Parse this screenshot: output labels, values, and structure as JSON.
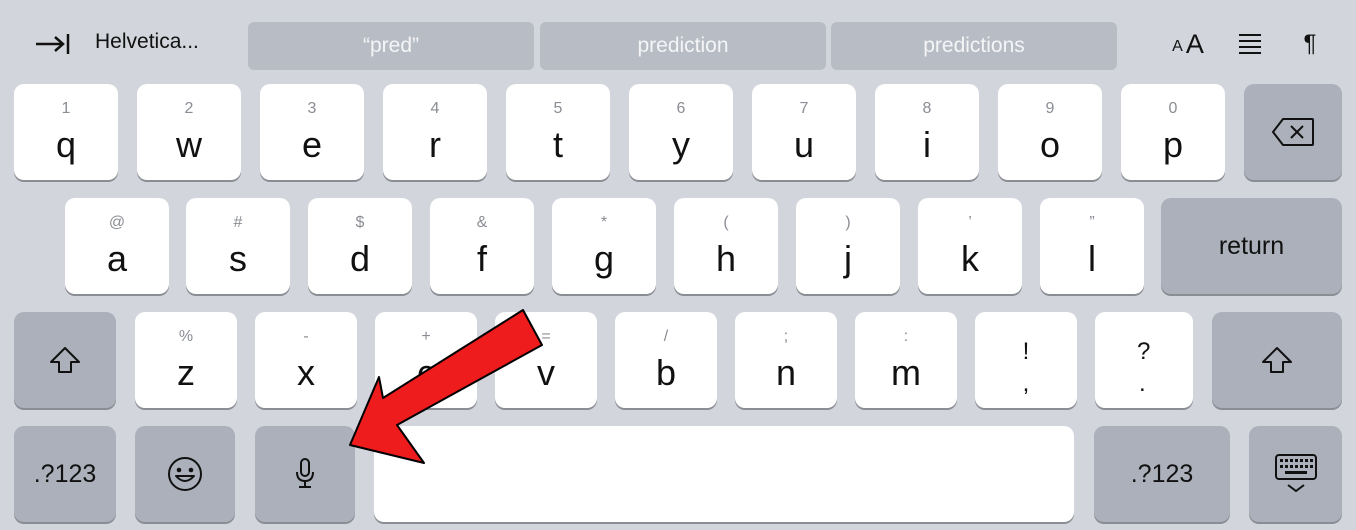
{
  "toolbar": {
    "tab_icon": "tab-icon",
    "font_label": "Helvetica...",
    "predictions": [
      "“pred”",
      "prediction",
      "predictions"
    ],
    "font_size_small": "A",
    "font_size_large": "A",
    "align_icon": "align-icon",
    "paragraph": "¶"
  },
  "rows": {
    "row1": [
      {
        "num": "1",
        "letter": "q"
      },
      {
        "num": "2",
        "letter": "w"
      },
      {
        "num": "3",
        "letter": "e"
      },
      {
        "num": "4",
        "letter": "r"
      },
      {
        "num": "5",
        "letter": "t"
      },
      {
        "num": "6",
        "letter": "y"
      },
      {
        "num": "7",
        "letter": "u"
      },
      {
        "num": "8",
        "letter": "i"
      },
      {
        "num": "9",
        "letter": "o"
      },
      {
        "num": "0",
        "letter": "p"
      }
    ],
    "row2": [
      {
        "num": "@",
        "letter": "a"
      },
      {
        "num": "#",
        "letter": "s"
      },
      {
        "num": "$",
        "letter": "d"
      },
      {
        "num": "&",
        "letter": "f"
      },
      {
        "num": "*",
        "letter": "g"
      },
      {
        "num": "(",
        "letter": "h"
      },
      {
        "num": ")",
        "letter": "j"
      },
      {
        "num": "’",
        "letter": "k"
      },
      {
        "num": "”",
        "letter": "l"
      }
    ],
    "row3": [
      {
        "num": "%",
        "letter": "z"
      },
      {
        "num": "-",
        "letter": "x"
      },
      {
        "num": "+",
        "letter": "c"
      },
      {
        "num": "=",
        "letter": "v"
      },
      {
        "num": "/",
        "letter": "b"
      },
      {
        "num": ";",
        "letter": "n"
      },
      {
        "num": ":",
        "letter": "m"
      }
    ],
    "row3_punct": [
      {
        "top": "!",
        "bottom": ","
      },
      {
        "top": "?",
        "bottom": "."
      }
    ]
  },
  "keys": {
    "return": "return",
    "numbers_left": ".?123",
    "numbers_right": ".?123",
    "delete_icon": "delete-icon",
    "shift_icon": "shift-icon",
    "emoji_icon": "emoji-icon",
    "mic_icon": "microphone-icon",
    "hide_keyboard_icon": "keyboard-hide-icon"
  },
  "annotation": {
    "arrow_color": "#ee1c1c"
  }
}
